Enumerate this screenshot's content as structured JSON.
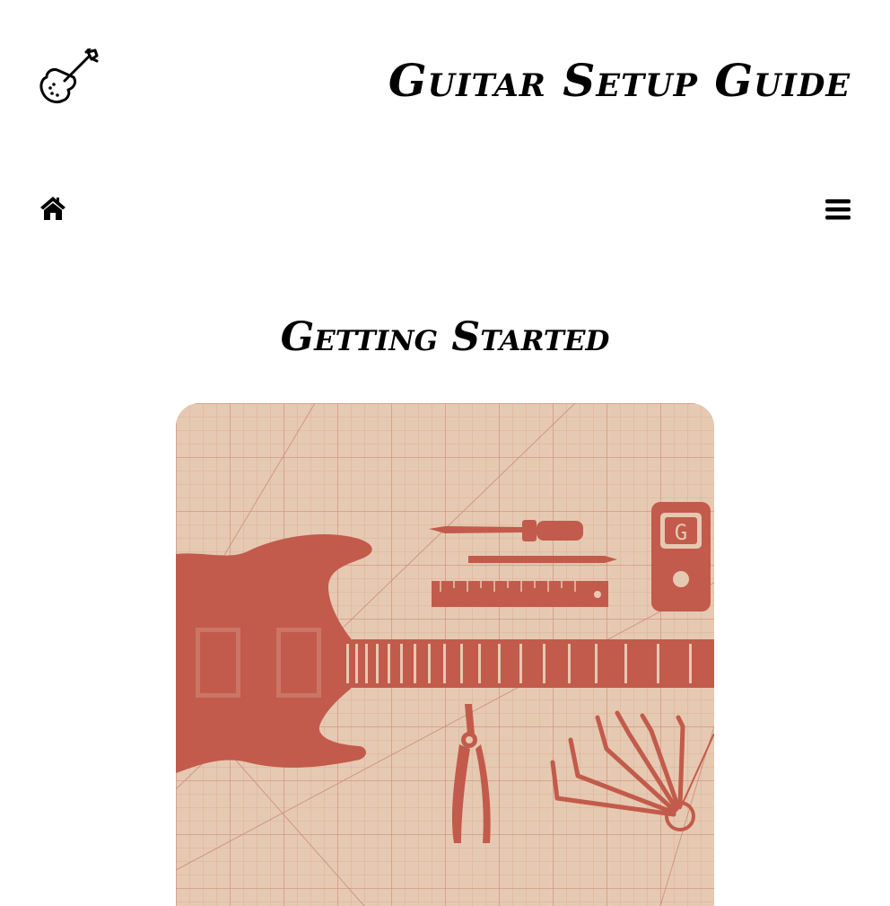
{
  "header": {
    "title": "Guitar Setup Guide",
    "logo_icon": "electric-guitar-icon"
  },
  "nav": {
    "home_icon": "home-icon",
    "menu_icon": "hamburger-menu-icon"
  },
  "main": {
    "heading": "Getting Started",
    "hero_image": {
      "depicts": "guitar-and-setup-tools-illustration",
      "tuner_display": "G"
    }
  },
  "colors": {
    "text": "#000000",
    "background": "#ffffff",
    "illustration_bg": "#e6c9b2",
    "illustration_ink": "#c25b4b",
    "grid_line": "#d49a86"
  }
}
